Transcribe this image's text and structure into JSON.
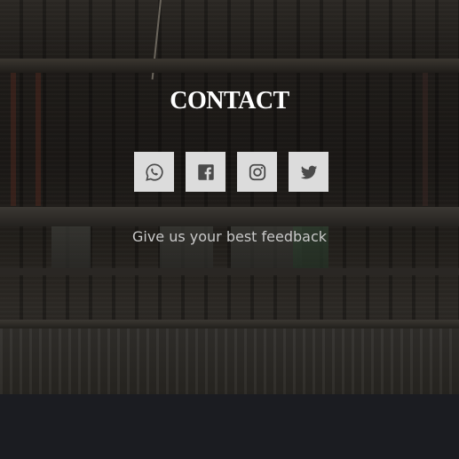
{
  "contact": {
    "title": "CONTACT",
    "tagline": "Give us your best feedback",
    "socials": [
      {
        "name": "whatsapp",
        "icon": "whatsapp-icon"
      },
      {
        "name": "facebook",
        "icon": "facebook-icon"
      },
      {
        "name": "instagram",
        "icon": "instagram-icon"
      },
      {
        "name": "twitter",
        "icon": "twitter-icon"
      }
    ]
  },
  "colors": {
    "title": "#ffffff",
    "tagline": "#c9c9c9",
    "social_bg": "#dcdcdc",
    "social_icon": "#4a4a4a",
    "footer_bg": "#1b1c21"
  }
}
